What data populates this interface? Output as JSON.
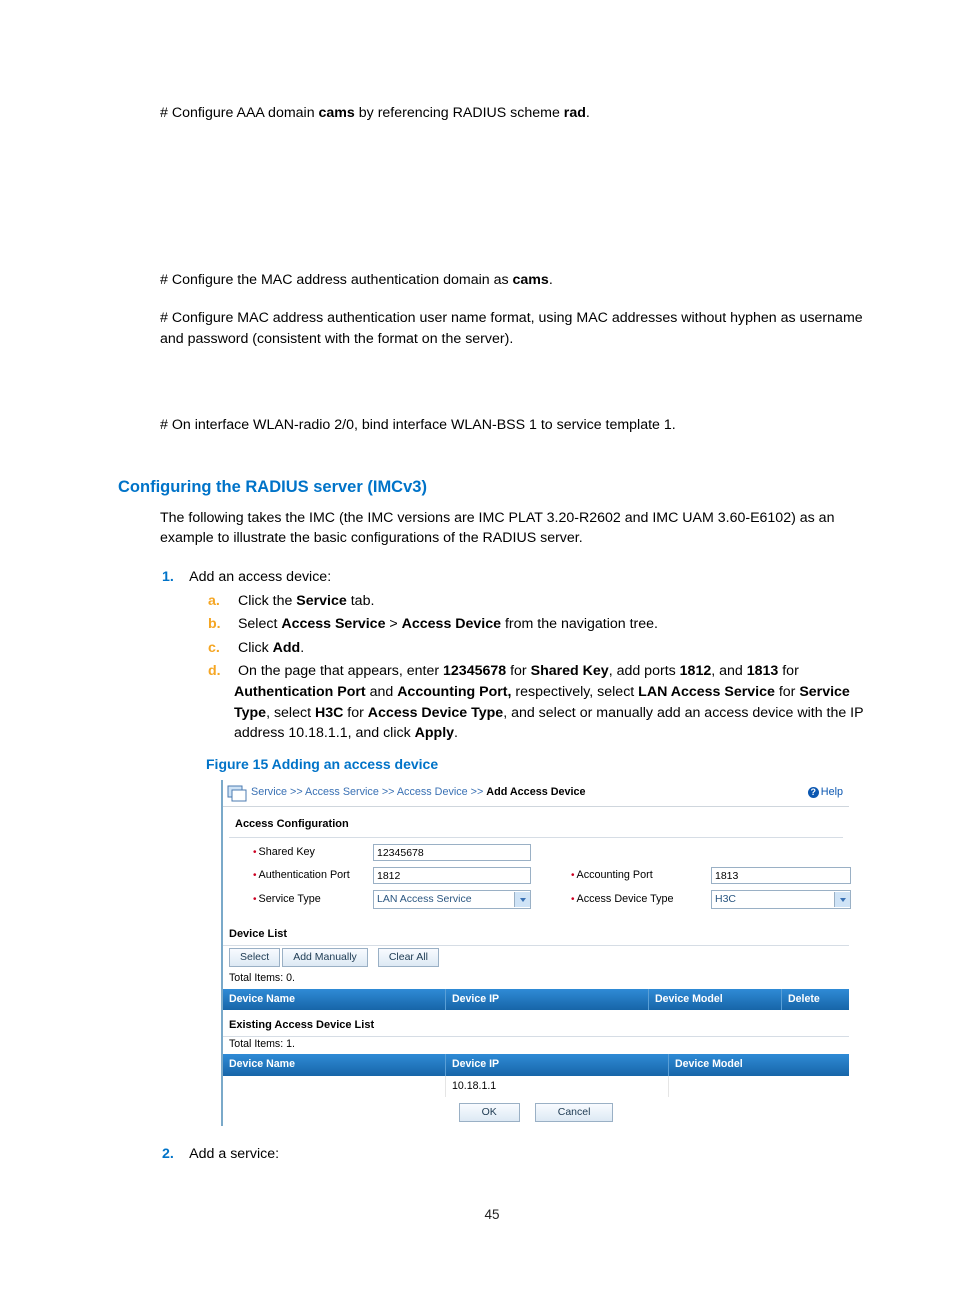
{
  "page_number": "45",
  "p1_a": "# Configure AAA domain ",
  "p1_b": "cams",
  "p1_c": " by referencing RADIUS scheme ",
  "p1_d": "rad",
  "p1_e": ".",
  "p2_a": "# Configure the MAC address authentication domain as ",
  "p2_b": "cams",
  "p2_c": ".",
  "p3": "# Configure MAC address authentication user name format, using MAC addresses without hyphen as username and password (consistent with the format on the server).",
  "p4": "# On interface WLAN-radio 2/0, bind interface WLAN-BSS 1 to service template 1.",
  "h3": "Configuring the RADIUS server (IMCv3)",
  "intro": "The following takes the IMC (the IMC versions are IMC PLAT 3.20-R2602 and IMC UAM 3.60-E6102) as an example to illustrate the basic configurations of the RADIUS server.",
  "li1_num": "1.",
  "li1": "Add an access device:",
  "li1a_let": "a.",
  "li1a_a": "Click the ",
  "li1a_b": "Service",
  "li1a_c": " tab.",
  "li1b_let": "b.",
  "li1b_a": "Select ",
  "li1b_b": "Access Service",
  "li1b_c": " > ",
  "li1b_d": "Access Device",
  "li1b_e": " from the navigation tree.",
  "li1c_let": "c.",
  "li1c_a": "Click ",
  "li1c_b": "Add",
  "li1c_c": ".",
  "li1d_let": "d.",
  "li1d_1": "On the page that appears, enter ",
  "li1d_2": "12345678",
  "li1d_3": " for ",
  "li1d_4": "Shared Key",
  "li1d_5": ", add ports ",
  "li1d_6": "1812",
  "li1d_7": ", and ",
  "li1d_8": "1813",
  "li1d_9": " for ",
  "li1d_10": "Authentication Port",
  "li1d_11": " and ",
  "li1d_12": "Accounting Port,",
  "li1d_13": " respectively, select ",
  "li1d_14": "LAN Access Service",
  "li1d_15": " for ",
  "li1d_16": "Service Type",
  "li1d_17": ", select ",
  "li1d_18": "H3C",
  "li1d_19": " for ",
  "li1d_20": "Access Device Type",
  "li1d_21": ", and select or manually add an access device with the IP address 10.18.1.1, and click ",
  "li1d_22": "Apply",
  "li1d_23": ".",
  "fig_caption": "Figure 15 Adding an access device",
  "li2_num": "2.",
  "li2": "Add a service:",
  "fig": {
    "breadcrumb": {
      "a": "Service",
      "b": "Access Service",
      "c": "Access Device",
      "d": "Add Access Device",
      "sep": " >> "
    },
    "help": "Help",
    "section1": "Access Configuration",
    "labels": {
      "shared_key": "Shared Key",
      "auth_port": "Authentication Port",
      "acct_port": "Accounting Port",
      "service_type": "Service Type",
      "dev_type": "Access Device Type"
    },
    "values": {
      "shared_key": "12345678",
      "auth_port": "1812",
      "acct_port": "1813",
      "service_type": "LAN Access Service",
      "dev_type": "H3C"
    },
    "section2": "Device List",
    "btn_select": "Select",
    "btn_add_manually": "Add Manually",
    "btn_clear_all": "Clear All",
    "total0": "Total Items: 0.",
    "hdr1": {
      "name": "Device Name",
      "ip": "Device IP",
      "model": "Device Model",
      "del": "Delete"
    },
    "section3": "Existing Access Device List",
    "total1": "Total Items: 1.",
    "hdr2": {
      "name": "Device Name",
      "ip": "Device IP",
      "model": "Device Model"
    },
    "row_ip": "10.18.1.1",
    "ok": "OK",
    "cancel": "Cancel"
  }
}
